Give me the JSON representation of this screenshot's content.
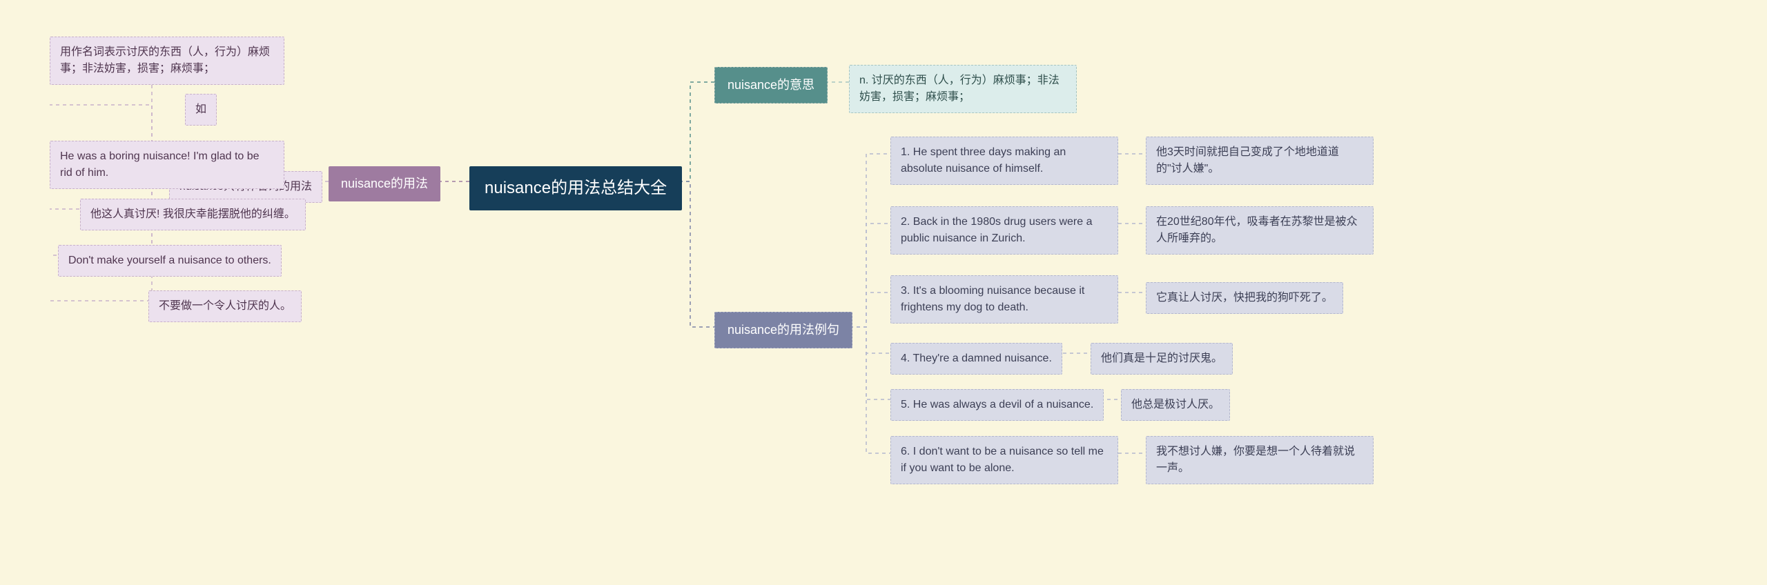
{
  "root": "nuisance的用法总结大全",
  "left": {
    "usage_title": "nuisance的用法",
    "noun_only": "nuisance只有作名词的用法",
    "items": [
      "用作名词表示讨厌的东西（人，行为）麻烦事；非法妨害，损害；麻烦事；",
      "如",
      "He was a boring nuisance! I'm glad to be rid of him.",
      "他这人真讨厌! 我很庆幸能摆脱他的纠缠。",
      "Don't make yourself a nuisance to others.",
      "不要做一个令人讨厌的人。"
    ]
  },
  "right": {
    "meaning_title": "nuisance的意思",
    "meaning_text": "n. 讨厌的东西（人，行为）麻烦事；非法妨害，损害；麻烦事；",
    "examples_title": "nuisance的用法例句",
    "examples": [
      {
        "en": "1. He spent three days making an absolute nuisance of himself.",
        "zh": "他3天时间就把自己变成了个地地道道的\"讨人嫌\"。"
      },
      {
        "en": "2. Back in the 1980s drug users were a public nuisance in Zurich.",
        "zh": "在20世纪80年代，吸毒者在苏黎世是被众人所唾弃的。"
      },
      {
        "en": "3. It's a blooming nuisance because it frightens my dog to death.",
        "zh": "它真让人讨厌，快把我的狗吓死了。"
      },
      {
        "en": "4. They're a damned nuisance.",
        "zh": "他们真是十足的讨厌鬼。"
      },
      {
        "en": "5. He was always a devil of a nuisance.",
        "zh": "他总是极讨人厌。"
      },
      {
        "en": "6. I don't want to be a nuisance so tell me if you want to be alone.",
        "zh": "我不想讨人嫌，你要是想一个人待着就说一声。"
      }
    ]
  }
}
